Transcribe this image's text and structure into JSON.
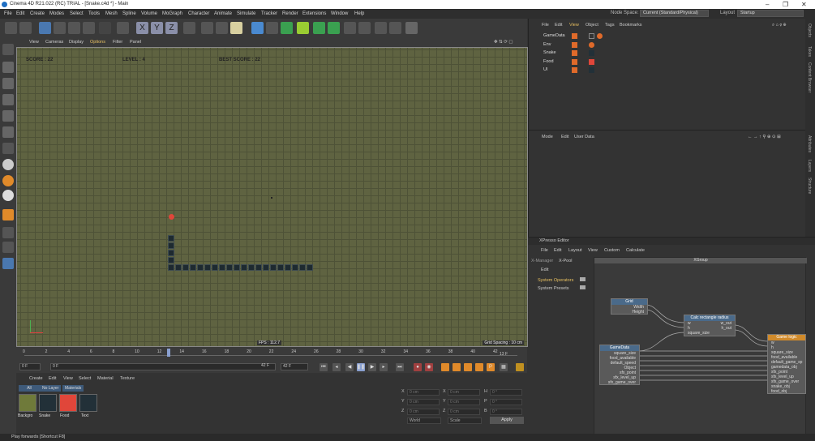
{
  "app": {
    "title": "Cinema 4D R21.022 (RC) TRIAL - [Snake.c4d *] - Main"
  },
  "menu": [
    "File",
    "Edit",
    "Create",
    "Modes",
    "Select",
    "Tools",
    "Mesh",
    "Spline",
    "Volume",
    "MoGraph",
    "Character",
    "Animate",
    "Simulate",
    "Tracker",
    "Render",
    "Extensions",
    "Window",
    "Help"
  ],
  "node_space": {
    "label": "Node Space:",
    "value": "Current (Standard/Physical)"
  },
  "layout": {
    "label": "Layout",
    "value": "Startup"
  },
  "viewport": {
    "menu": [
      "View",
      "Cameras",
      "Display",
      "Options",
      "Filter",
      "Panel"
    ],
    "hud": {
      "score": "SCORE : 22",
      "level": "LEVEL : 4",
      "best": "BEST SCORE : 22"
    },
    "fps": "FPS : 112.7",
    "grid_spacing": "Grid Spacing : 10 cm"
  },
  "timeline": {
    "ticks": [
      "0",
      "2",
      "4",
      "6",
      "8",
      "10",
      "12",
      "14",
      "16",
      "18",
      "20",
      "22",
      "24",
      "26",
      "28",
      "30",
      "32",
      "34",
      "36",
      "38",
      "40",
      "42"
    ],
    "current": "13 F"
  },
  "transport": {
    "start": "0 F",
    "current": "0 F",
    "end": "42 F",
    "end2": "42 F"
  },
  "materials": {
    "menu": [
      "Create",
      "Edit",
      "View",
      "Select",
      "Material",
      "Texture"
    ],
    "filters": [
      "All",
      "No Layer",
      "Materials"
    ],
    "items": [
      {
        "label": "Backgro",
        "color": "#6f7a3a"
      },
      {
        "label": "Snake",
        "color": "#223038"
      },
      {
        "label": "Food",
        "color": "#e0463a"
      },
      {
        "label": "Text",
        "color": "#223038"
      }
    ]
  },
  "coords": {
    "labels": [
      "X",
      "Y",
      "Z"
    ],
    "field_pos": "0 cm",
    "field_rot": "0 °",
    "pos_labels": [
      "X",
      "Y",
      "Z"
    ],
    "rot_labels": [
      "H",
      "P",
      "B"
    ],
    "world": "World",
    "scale": "Scale",
    "apply": "Apply"
  },
  "objects": {
    "menu": [
      "File",
      "Edit",
      "View",
      "Object",
      "Tags",
      "Bookmarks"
    ],
    "rows": [
      {
        "name": "GameData",
        "color": "#e06a2a"
      },
      {
        "name": "Env",
        "color": "#e06a2a"
      },
      {
        "name": "Snake",
        "color": "#223038"
      },
      {
        "name": "Food",
        "color": "#e0463a"
      },
      {
        "name": "UI",
        "color": "#223038"
      }
    ]
  },
  "attributes": {
    "menu": [
      "Mode",
      "Edit",
      "User Data"
    ]
  },
  "right_tabs": [
    "Objects",
    "Takes",
    "Content Browser",
    "Attributes",
    "Layers",
    "Structure"
  ],
  "xpresso": {
    "title": "XPresso Editor",
    "menu": [
      "File",
      "Edit",
      "Layout",
      "View",
      "Custom",
      "Calculate"
    ],
    "tabs": [
      "X-Manager",
      "X-Pool"
    ],
    "pool_edit": "Edit",
    "pool_items": [
      "System Operators",
      "System Presets"
    ],
    "group": "XGroup",
    "nodes": {
      "grid": {
        "title": "Grid",
        "ports": [
          "Width",
          "Height"
        ]
      },
      "calc": {
        "title": "Calc rectangle radius",
        "in": [
          "w",
          "h",
          "square_size"
        ],
        "out": [
          "w_out",
          "h_out"
        ]
      },
      "gamedata": {
        "title": "GameData",
        "ports": [
          "square_size",
          "food_available",
          "default_speed",
          "Object",
          "sfx_point",
          "sfx_level_up",
          "sfx_game_over"
        ]
      },
      "logic": {
        "title": "Game logic",
        "ports": [
          "w",
          "h",
          "square_size",
          "food_available",
          "default_game_sp",
          "gamedata_obj",
          "sfx_point",
          "sfx_level_up",
          "sfx_game_over",
          "snake_obj",
          "food_obj"
        ]
      }
    }
  },
  "status": "Play forwards [Shortcut F8]"
}
